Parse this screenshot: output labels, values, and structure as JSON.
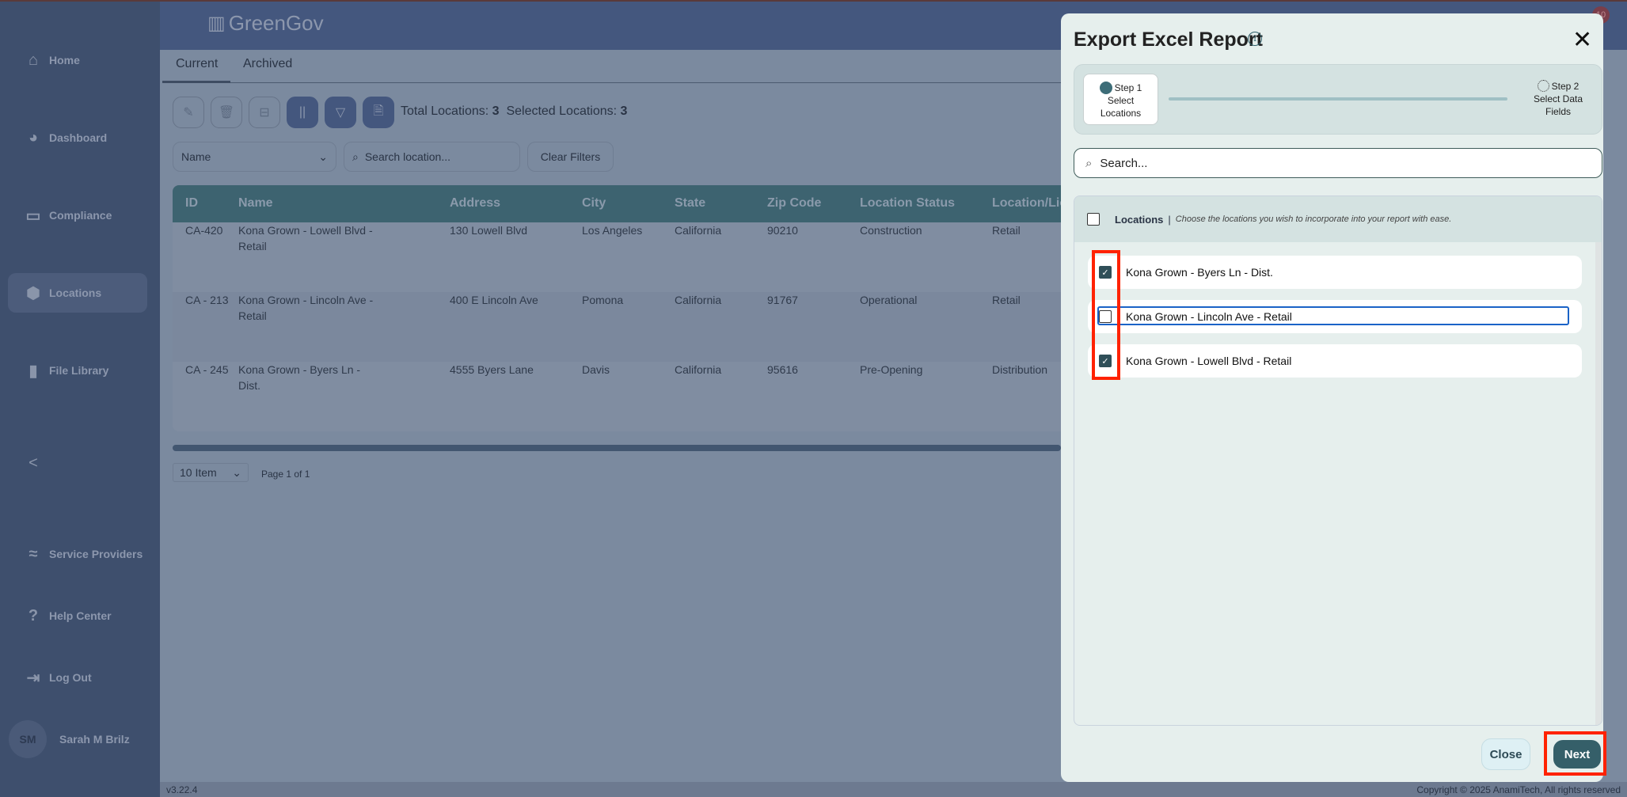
{
  "app": {
    "brand": "GreenGov",
    "notification_count": "10",
    "version": "v3.22.4",
    "copyright": "Copyright © 2025 AnamiTech, All rights reserved"
  },
  "sidebar": {
    "items": [
      {
        "label": "Home",
        "icon": "home-icon"
      },
      {
        "label": "Dashboard",
        "icon": "pie-chart-icon"
      },
      {
        "label": "Compliance",
        "icon": "inbox-icon"
      },
      {
        "label": "Locations",
        "icon": "map-pin-icon",
        "active": true
      },
      {
        "label": "File Library",
        "icon": "file-icon"
      },
      {
        "label": "Service Providers",
        "icon": "handshake-icon"
      },
      {
        "label": "Help Center",
        "icon": "help-icon"
      },
      {
        "label": "Log Out",
        "icon": "logout-icon"
      }
    ],
    "collapse": "<",
    "user": {
      "initials": "SM",
      "name": "Sarah M Brilz"
    }
  },
  "tabs": [
    "Current",
    "Archived"
  ],
  "toolbar": {
    "total_label": "Total Locations:",
    "total": "3",
    "selected_label": "Selected Locations:",
    "selected": "3"
  },
  "filters": {
    "field": "Name",
    "search_placeholder": "Search location...",
    "clear": "Clear Filters"
  },
  "table": {
    "columns": [
      "ID",
      "Name",
      "Address",
      "City",
      "State",
      "Zip Code",
      "Location Status",
      "Location/Lic"
    ],
    "rows": [
      [
        "CA-420",
        "Kona Grown - Lowell Blvd - Retail",
        "130 Lowell Blvd",
        "Los Angeles",
        "California",
        "90210",
        "Construction",
        "Retail"
      ],
      [
        "CA - 213",
        "Kona Grown - Lincoln Ave - Retail",
        "400 E Lincoln Ave",
        "Pomona",
        "California",
        "91767",
        "Operational",
        "Retail"
      ],
      [
        "CA - 245",
        "Kona Grown - Byers Ln - Dist.",
        "4555 Byers Lane",
        "Davis",
        "California",
        "95616",
        "Pre-Opening",
        "Distribution"
      ]
    ]
  },
  "pagination": {
    "per_page": "10 Item",
    "page": "Page 1 of 1"
  },
  "modal": {
    "title": "Export Excel Report",
    "steps": [
      {
        "num": "Step 1",
        "label": "Select Locations"
      },
      {
        "num": "Step 2",
        "label": "Select Data Fields"
      }
    ],
    "search_placeholder": "Search...",
    "list_title": "Locations",
    "list_hint": "Choose the locations you wish to incorporate into your report with ease.",
    "items": [
      {
        "label": "Kona Grown - Byers Ln - Dist.",
        "checked": true
      },
      {
        "label": "Kona Grown - Lincoln Ave - Retail",
        "checked": false
      },
      {
        "label": "Kona Grown - Lowell Blvd - Retail",
        "checked": true
      }
    ],
    "close": "Close",
    "next": "Next"
  },
  "colors": {
    "accent": "#2f5f6a",
    "highlight": "#ff2200"
  }
}
